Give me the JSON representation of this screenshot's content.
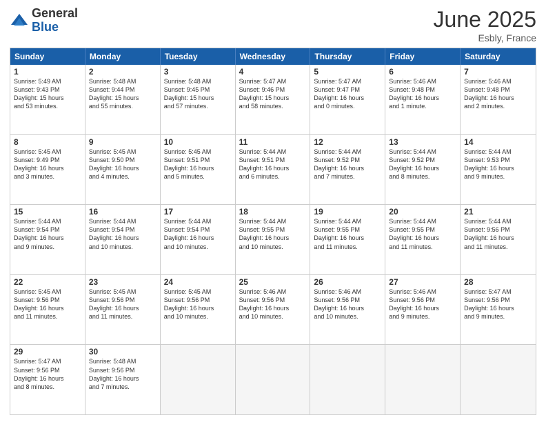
{
  "logo": {
    "general": "General",
    "blue": "Blue"
  },
  "title": {
    "month_year": "June 2025",
    "location": "Esbly, France"
  },
  "calendar": {
    "headers": [
      "Sunday",
      "Monday",
      "Tuesday",
      "Wednesday",
      "Thursday",
      "Friday",
      "Saturday"
    ],
    "rows": [
      [
        {
          "day": "1",
          "info": "Sunrise: 5:49 AM\nSunset: 9:43 PM\nDaylight: 15 hours\nand 53 minutes."
        },
        {
          "day": "2",
          "info": "Sunrise: 5:48 AM\nSunset: 9:44 PM\nDaylight: 15 hours\nand 55 minutes."
        },
        {
          "day": "3",
          "info": "Sunrise: 5:48 AM\nSunset: 9:45 PM\nDaylight: 15 hours\nand 57 minutes."
        },
        {
          "day": "4",
          "info": "Sunrise: 5:47 AM\nSunset: 9:46 PM\nDaylight: 15 hours\nand 58 minutes."
        },
        {
          "day": "5",
          "info": "Sunrise: 5:47 AM\nSunset: 9:47 PM\nDaylight: 16 hours\nand 0 minutes."
        },
        {
          "day": "6",
          "info": "Sunrise: 5:46 AM\nSunset: 9:48 PM\nDaylight: 16 hours\nand 1 minute."
        },
        {
          "day": "7",
          "info": "Sunrise: 5:46 AM\nSunset: 9:48 PM\nDaylight: 16 hours\nand 2 minutes."
        }
      ],
      [
        {
          "day": "8",
          "info": "Sunrise: 5:45 AM\nSunset: 9:49 PM\nDaylight: 16 hours\nand 3 minutes."
        },
        {
          "day": "9",
          "info": "Sunrise: 5:45 AM\nSunset: 9:50 PM\nDaylight: 16 hours\nand 4 minutes."
        },
        {
          "day": "10",
          "info": "Sunrise: 5:45 AM\nSunset: 9:51 PM\nDaylight: 16 hours\nand 5 minutes."
        },
        {
          "day": "11",
          "info": "Sunrise: 5:44 AM\nSunset: 9:51 PM\nDaylight: 16 hours\nand 6 minutes."
        },
        {
          "day": "12",
          "info": "Sunrise: 5:44 AM\nSunset: 9:52 PM\nDaylight: 16 hours\nand 7 minutes."
        },
        {
          "day": "13",
          "info": "Sunrise: 5:44 AM\nSunset: 9:52 PM\nDaylight: 16 hours\nand 8 minutes."
        },
        {
          "day": "14",
          "info": "Sunrise: 5:44 AM\nSunset: 9:53 PM\nDaylight: 16 hours\nand 9 minutes."
        }
      ],
      [
        {
          "day": "15",
          "info": "Sunrise: 5:44 AM\nSunset: 9:54 PM\nDaylight: 16 hours\nand 9 minutes."
        },
        {
          "day": "16",
          "info": "Sunrise: 5:44 AM\nSunset: 9:54 PM\nDaylight: 16 hours\nand 10 minutes."
        },
        {
          "day": "17",
          "info": "Sunrise: 5:44 AM\nSunset: 9:54 PM\nDaylight: 16 hours\nand 10 minutes."
        },
        {
          "day": "18",
          "info": "Sunrise: 5:44 AM\nSunset: 9:55 PM\nDaylight: 16 hours\nand 10 minutes."
        },
        {
          "day": "19",
          "info": "Sunrise: 5:44 AM\nSunset: 9:55 PM\nDaylight: 16 hours\nand 11 minutes."
        },
        {
          "day": "20",
          "info": "Sunrise: 5:44 AM\nSunset: 9:55 PM\nDaylight: 16 hours\nand 11 minutes."
        },
        {
          "day": "21",
          "info": "Sunrise: 5:44 AM\nSunset: 9:56 PM\nDaylight: 16 hours\nand 11 minutes."
        }
      ],
      [
        {
          "day": "22",
          "info": "Sunrise: 5:45 AM\nSunset: 9:56 PM\nDaylight: 16 hours\nand 11 minutes."
        },
        {
          "day": "23",
          "info": "Sunrise: 5:45 AM\nSunset: 9:56 PM\nDaylight: 16 hours\nand 11 minutes."
        },
        {
          "day": "24",
          "info": "Sunrise: 5:45 AM\nSunset: 9:56 PM\nDaylight: 16 hours\nand 10 minutes."
        },
        {
          "day": "25",
          "info": "Sunrise: 5:46 AM\nSunset: 9:56 PM\nDaylight: 16 hours\nand 10 minutes."
        },
        {
          "day": "26",
          "info": "Sunrise: 5:46 AM\nSunset: 9:56 PM\nDaylight: 16 hours\nand 10 minutes."
        },
        {
          "day": "27",
          "info": "Sunrise: 5:46 AM\nSunset: 9:56 PM\nDaylight: 16 hours\nand 9 minutes."
        },
        {
          "day": "28",
          "info": "Sunrise: 5:47 AM\nSunset: 9:56 PM\nDaylight: 16 hours\nand 9 minutes."
        }
      ],
      [
        {
          "day": "29",
          "info": "Sunrise: 5:47 AM\nSunset: 9:56 PM\nDaylight: 16 hours\nand 8 minutes."
        },
        {
          "day": "30",
          "info": "Sunrise: 5:48 AM\nSunset: 9:56 PM\nDaylight: 16 hours\nand 7 minutes."
        },
        {
          "day": "",
          "info": ""
        },
        {
          "day": "",
          "info": ""
        },
        {
          "day": "",
          "info": ""
        },
        {
          "day": "",
          "info": ""
        },
        {
          "day": "",
          "info": ""
        }
      ]
    ]
  }
}
